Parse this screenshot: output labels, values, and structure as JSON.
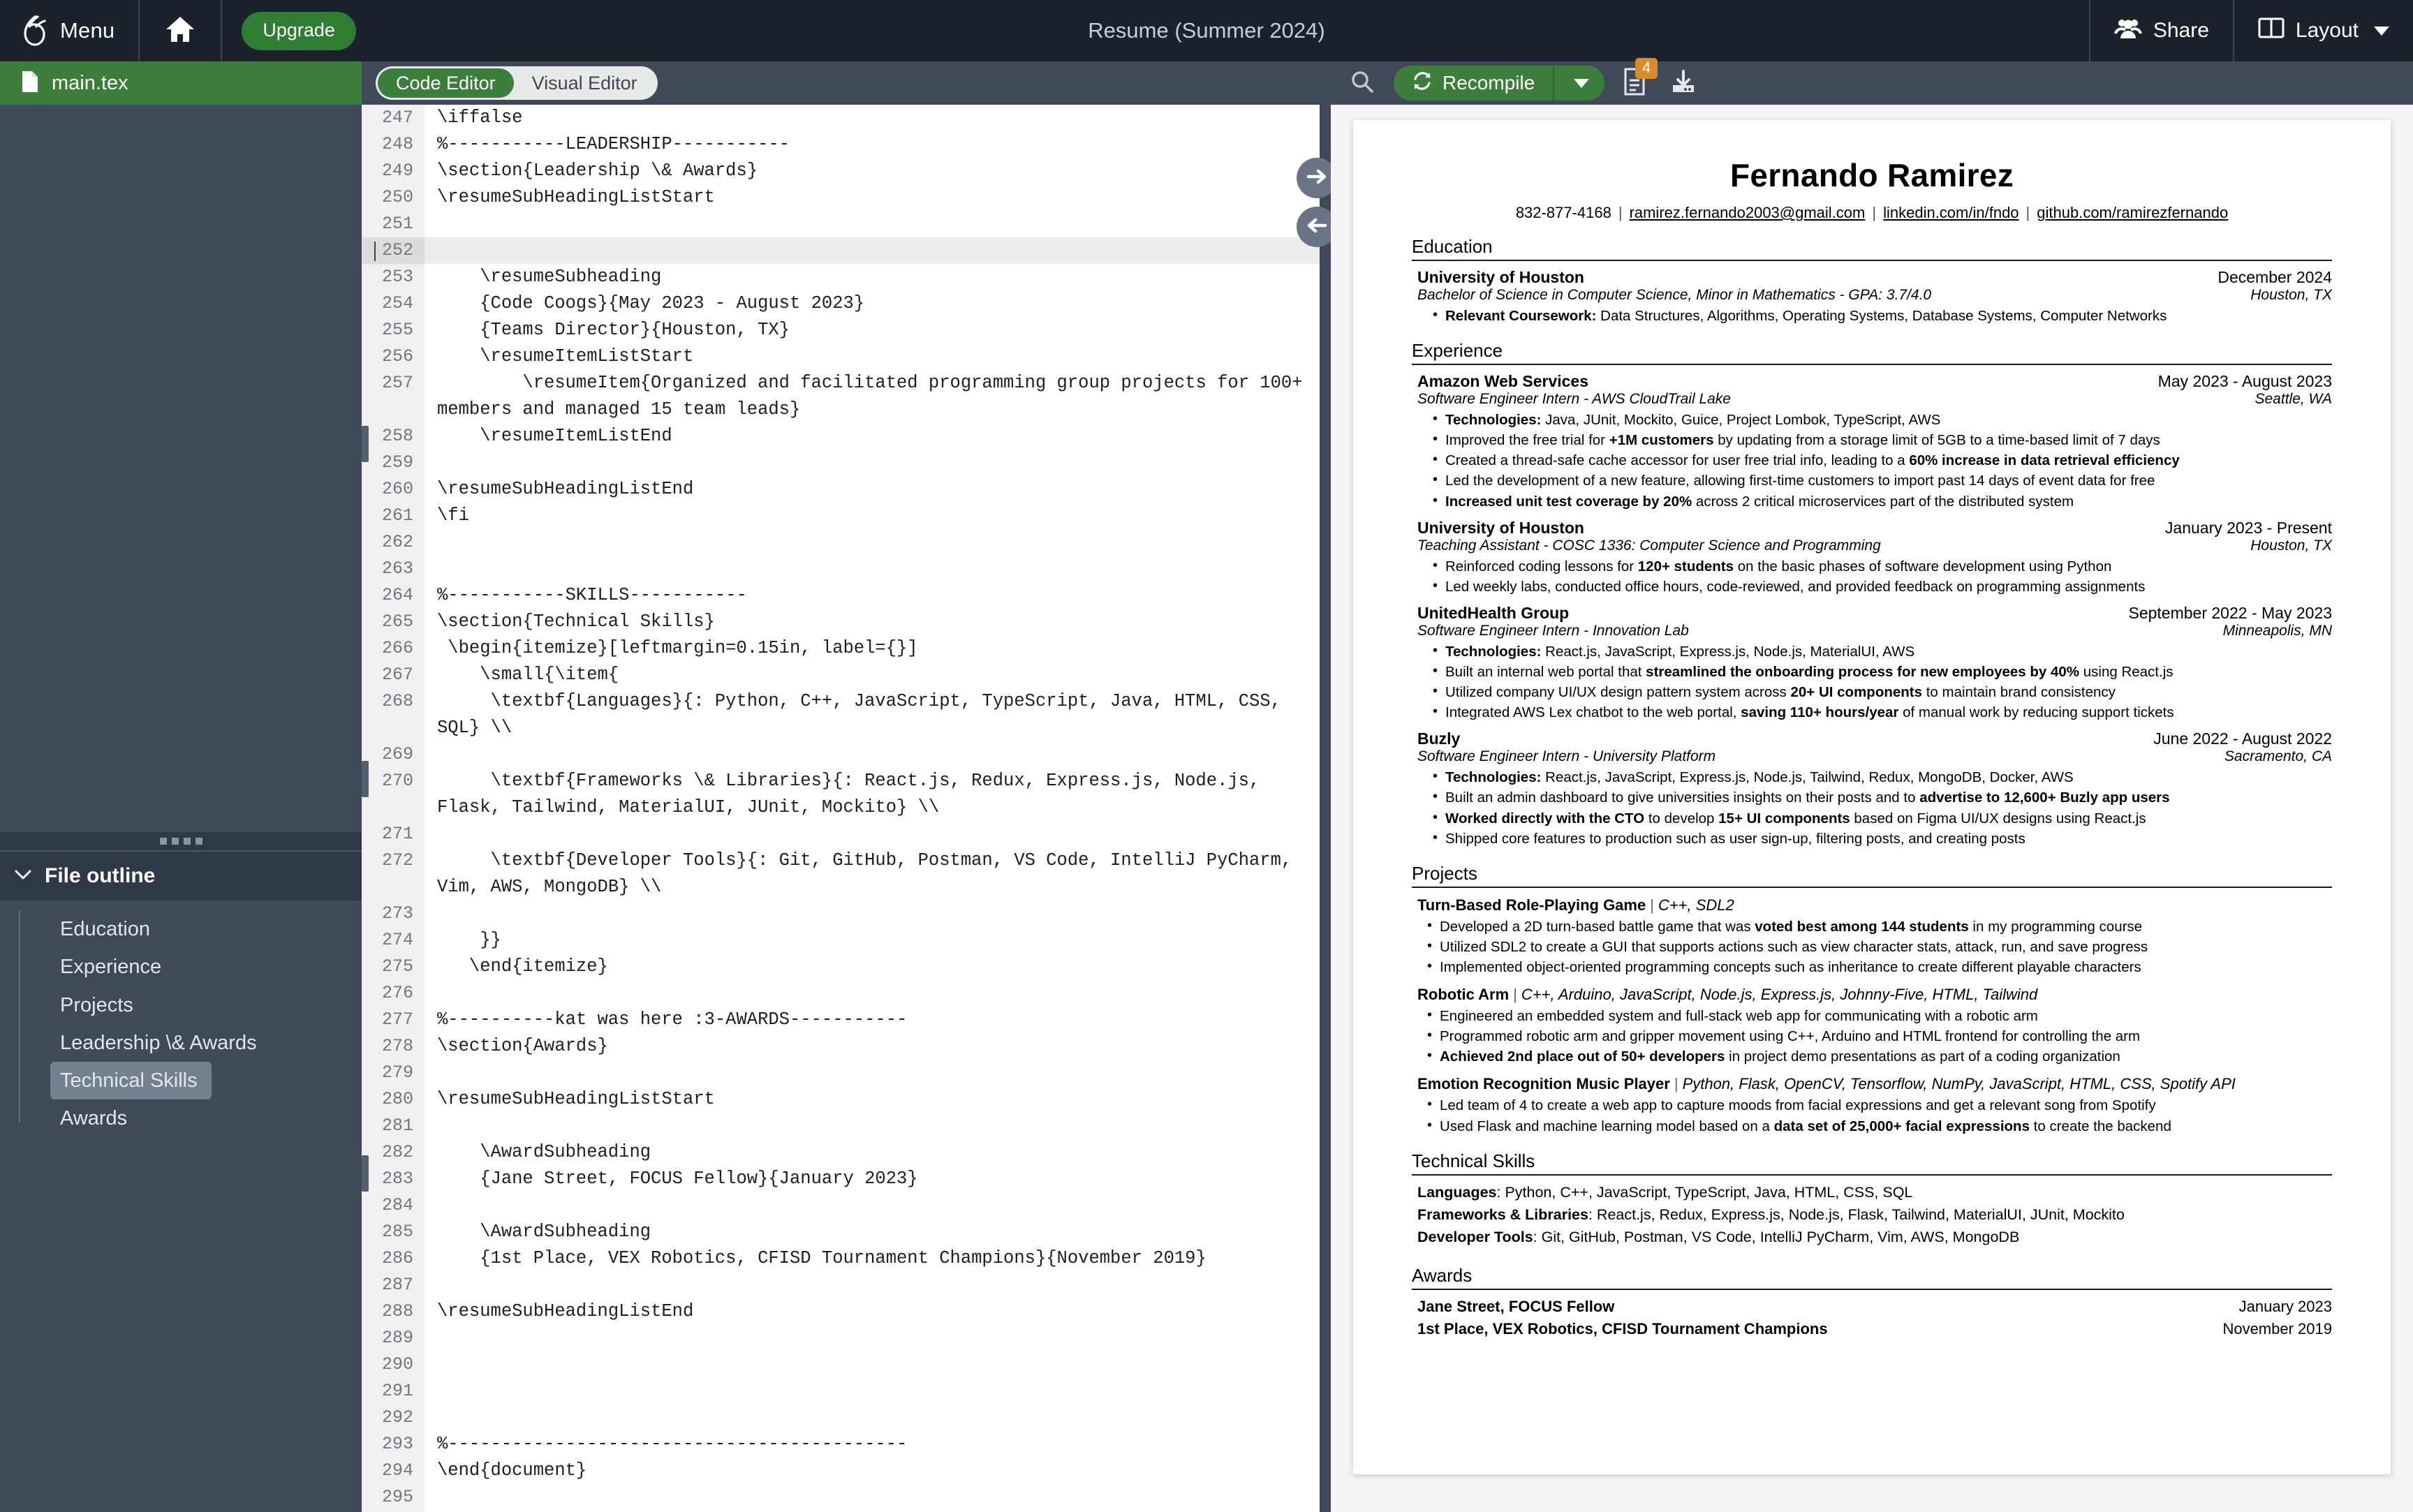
{
  "topbar": {
    "menu_label": "Menu",
    "upgrade_label": "Upgrade",
    "project_title": "Resume (Summer 2024)",
    "share_label": "Share",
    "layout_label": "Layout"
  },
  "sidebar": {
    "file_name": "main.tex",
    "outline_title": "File outline",
    "outline_items": [
      {
        "label": "Education",
        "active": false
      },
      {
        "label": "Experience",
        "active": false
      },
      {
        "label": "Projects",
        "active": false
      },
      {
        "label": "Leadership \\& Awards",
        "active": false
      },
      {
        "label": "Technical Skills",
        "active": true
      },
      {
        "label": "Awards",
        "active": false
      }
    ]
  },
  "editor_toolbar": {
    "tab_code": "Code Editor",
    "tab_visual": "Visual Editor",
    "active_tab": "Code Editor"
  },
  "pdf_toolbar": {
    "recompile_label": "Recompile",
    "logs_badge": "4"
  },
  "code": {
    "lines": [
      {
        "n": "247",
        "t": "\\iffalse"
      },
      {
        "n": "248",
        "t": "%-----------LEADERSHIP-----------"
      },
      {
        "n": "249",
        "t": "\\section{Leadership \\& Awards}"
      },
      {
        "n": "250",
        "t": "\\resumeSubHeadingListStart"
      },
      {
        "n": "251",
        "t": ""
      },
      {
        "n": "252",
        "t": "",
        "highlight": true
      },
      {
        "n": "253",
        "t": "    \\resumeSubheading"
      },
      {
        "n": "254",
        "t": "    {Code Coogs}{May 2023 - August 2023}"
      },
      {
        "n": "255",
        "t": "    {Teams Director}{Houston, TX}"
      },
      {
        "n": "256",
        "t": "    \\resumeItemListStart"
      },
      {
        "n": "257",
        "t": "        \\resumeItem{Organized and facilitated programming group projects for 100+ members and managed 15 team leads}",
        "wrap": true
      },
      {
        "n": "258",
        "t": "    \\resumeItemListEnd"
      },
      {
        "n": "259",
        "t": ""
      },
      {
        "n": "260",
        "t": "\\resumeSubHeadingListEnd"
      },
      {
        "n": "261",
        "t": "\\fi"
      },
      {
        "n": "262",
        "t": ""
      },
      {
        "n": "263",
        "t": ""
      },
      {
        "n": "264",
        "t": "%-----------SKILLS-----------"
      },
      {
        "n": "265",
        "t": "\\section{Technical Skills}"
      },
      {
        "n": "266",
        "t": " \\begin{itemize}[leftmargin=0.15in, label={}]"
      },
      {
        "n": "267",
        "t": "    \\small{\\item{"
      },
      {
        "n": "268",
        "t": "     \\textbf{Languages}{: Python, C++, JavaScript, TypeScript, Java, HTML, CSS, SQL} \\\\",
        "wrap": true
      },
      {
        "n": "269",
        "t": ""
      },
      {
        "n": "270",
        "t": "     \\textbf{Frameworks \\& Libraries}{: React.js, Redux, Express.js, Node.js, Flask, Tailwind, MaterialUI, JUnit, Mockito} \\\\",
        "wrap": true
      },
      {
        "n": "271",
        "t": ""
      },
      {
        "n": "272",
        "t": "     \\textbf{Developer Tools}{: Git, GitHub, Postman, VS Code, IntelliJ PyCharm, Vim, AWS, MongoDB} \\\\",
        "wrap": true
      },
      {
        "n": "273",
        "t": ""
      },
      {
        "n": "274",
        "t": "    }}"
      },
      {
        "n": "275",
        "t": "   \\end{itemize}"
      },
      {
        "n": "276",
        "t": ""
      },
      {
        "n": "277",
        "t": "%----------kat was here :3-AWARDS-----------"
      },
      {
        "n": "278",
        "t": "\\section{Awards}"
      },
      {
        "n": "279",
        "t": ""
      },
      {
        "n": "280",
        "t": "\\resumeSubHeadingListStart"
      },
      {
        "n": "281",
        "t": ""
      },
      {
        "n": "282",
        "t": "    \\AwardSubheading"
      },
      {
        "n": "283",
        "t": "    {Jane Street, FOCUS Fellow}{January 2023}"
      },
      {
        "n": "284",
        "t": ""
      },
      {
        "n": "285",
        "t": "    \\AwardSubheading"
      },
      {
        "n": "286",
        "t": "    {1st Place, VEX Robotics, CFISD Tournament Champions}{November 2019}"
      },
      {
        "n": "287",
        "t": ""
      },
      {
        "n": "288",
        "t": "\\resumeSubHeadingListEnd"
      },
      {
        "n": "289",
        "t": ""
      },
      {
        "n": "290",
        "t": ""
      },
      {
        "n": "291",
        "t": ""
      },
      {
        "n": "292",
        "t": ""
      },
      {
        "n": "293",
        "t": "%-------------------------------------------"
      },
      {
        "n": "294",
        "t": "\\end{document}"
      },
      {
        "n": "295",
        "t": ""
      }
    ]
  },
  "resume": {
    "name": "Fernando Ramirez",
    "contact": {
      "phone": "832-877-4168",
      "email": "ramirez.fernando2003@gmail.com",
      "linkedin": "linkedin.com/in/fndo",
      "github": "github.com/ramirezfernando"
    },
    "sections": {
      "education_title": "Education",
      "experience_title": "Experience",
      "projects_title": "Projects",
      "skills_title": "Technical Skills",
      "awards_title": "Awards"
    },
    "education": [
      {
        "org": "University of Houston",
        "date": "December 2024",
        "role": "Bachelor of Science in Computer Science, Minor in Mathematics - GPA: 3.7/4.0",
        "location": "Houston, TX",
        "bullets": [
          "<b>Relevant Coursework:</b> Data Structures, Algorithms, Operating Systems, Database Systems, Computer Networks"
        ]
      }
    ],
    "experience": [
      {
        "org": "Amazon Web Services",
        "date": "May 2023 - August 2023",
        "role": "Software Engineer Intern - AWS CloudTrail Lake",
        "location": "Seattle, WA",
        "bullets": [
          "<b>Technologies:</b> Java, JUnit, Mockito, Guice, Project Lombok, TypeScript, AWS",
          "Improved the free trial for <b>+1M customers</b> by updating from a storage limit of 5GB to a time-based limit of 7 days",
          "Created a thread-safe cache accessor for user free trial info, leading to a <b>60% increase in data retrieval efficiency</b>",
          "Led the development of a new feature, allowing first-time customers to import past 14 days of event data for free",
          "<b>Increased unit test coverage by 20%</b> across 2 critical microservices part of the distributed system"
        ]
      },
      {
        "org": "University of Houston",
        "date": "January 2023 - Present",
        "role": "Teaching Assistant - COSC 1336: Computer Science and Programming",
        "location": "Houston, TX",
        "bullets": [
          "Reinforced coding lessons for <b>120+ students</b> on the basic phases of software development using Python",
          "Led weekly labs, conducted office hours, code-reviewed, and provided feedback on programming assignments"
        ]
      },
      {
        "org": "UnitedHealth Group",
        "date": "September 2022 - May 2023",
        "role": "Software Engineer Intern - Innovation Lab",
        "location": "Minneapolis, MN",
        "bullets": [
          "<b>Technologies:</b> React.js, JavaScript, Express.js, Node.js, MaterialUI, AWS",
          "Built an internal web portal that <b>streamlined the onboarding process for new employees by 40%</b> using React.js",
          "Utilized company UI/UX design pattern system across <b>20+ UI components</b> to maintain brand consistency",
          "Integrated AWS Lex chatbot to the web portal, <b>saving 110+ hours/year</b> of manual work by reducing support tickets"
        ]
      },
      {
        "org": "Buzly",
        "date": "June 2022 - August 2022",
        "role": "Software Engineer Intern - University Platform",
        "location": "Sacramento, CA",
        "bullets": [
          "<b>Technologies:</b> React.js, JavaScript, Express.js, Node.js, Tailwind, Redux, MongoDB, Docker, AWS",
          "Built an admin dashboard to give universities insights on their posts and to <b>advertise to 12,600+ Buzly app users</b>",
          "<b>Worked directly with the CTO</b> to develop <b>15+ UI components</b> based on Figma UI/UX designs using React.js",
          "Shipped core features to production such as user sign-up, filtering posts, and creating posts"
        ]
      }
    ],
    "projects": [
      {
        "name": "Turn-Based Role-Playing Game",
        "tech": "C++, SDL2",
        "bullets": [
          "Developed a 2D turn-based battle game that was <b>voted best among 144 students</b> in my programming course",
          "Utilized SDL2 to create a GUI that supports actions such as view character stats, attack, run, and save progress",
          "Implemented object-oriented programming concepts such as inheritance to create different playable characters"
        ]
      },
      {
        "name": "Robotic Arm",
        "tech": "C++, Arduino, JavaScript, Node.js, Express.js, Johnny-Five, HTML, Tailwind",
        "bullets": [
          "Engineered an embedded system and full-stack web app for communicating with a robotic arm",
          "Programmed robotic arm and gripper movement using C++, Arduino and HTML frontend for controlling the arm",
          "<b>Achieved 2nd place out of 50+ developers</b> in project demo presentations as part of a coding organization"
        ]
      },
      {
        "name": "Emotion Recognition Music Player",
        "tech": "Python, Flask, OpenCV, Tensorflow, NumPy, JavaScript, HTML, CSS, Spotify API",
        "bullets": [
          "Led team of 4 to create a web app to capture moods from facial expressions and get a relevant song from Spotify",
          "Used Flask and machine learning model based on a <b>data set of 25,000+ facial expressions</b> to create the backend"
        ]
      }
    ],
    "skills": [
      {
        "label": "Languages",
        "value": "Python, C++, JavaScript, TypeScript, Java, HTML, CSS, SQL"
      },
      {
        "label": "Frameworks & Libraries",
        "value": "React.js, Redux, Express.js, Node.js, Flask, Tailwind, MaterialUI, JUnit, Mockito"
      },
      {
        "label": "Developer Tools",
        "value": "Git, GitHub, Postman, VS Code, IntelliJ PyCharm, Vim, AWS, MongoDB"
      }
    ],
    "awards": [
      {
        "name": "Jane Street, FOCUS Fellow",
        "date": "January 2023"
      },
      {
        "name": "1st Place, VEX Robotics, CFISD Tournament Champions",
        "date": "November 2019"
      }
    ]
  },
  "colors": {
    "brand_green": "#3c7f3c",
    "topbar_dark": "#1b222c",
    "panel": "#3f4957",
    "badge_orange": "#d98a2b"
  }
}
